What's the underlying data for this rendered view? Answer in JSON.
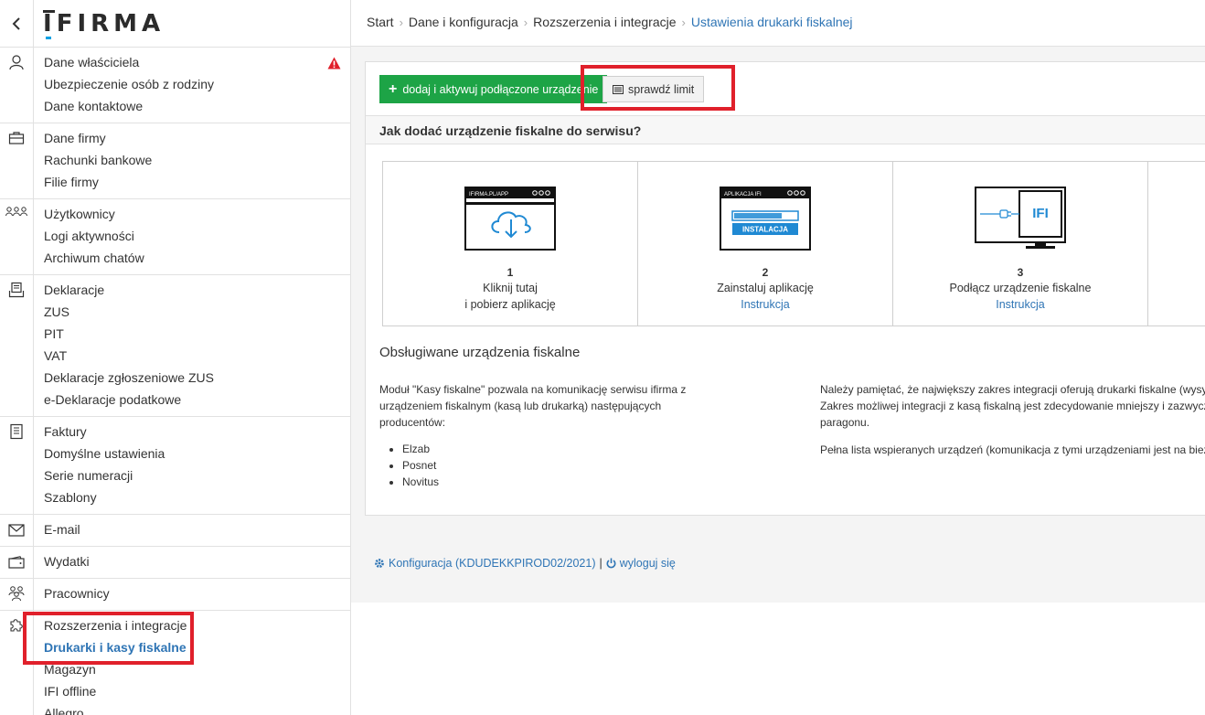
{
  "sidebar": {
    "logo_text": "IFIRMA",
    "back_label": "‹",
    "groups": [
      {
        "icon": "user-icon",
        "items": [
          "Dane właściciela",
          "Ubezpieczenie osób z rodziny",
          "Dane kontaktowe"
        ],
        "warning": true
      },
      {
        "icon": "briefcase-icon",
        "items": [
          "Dane firmy",
          "Rachunki bankowe",
          "Filie firmy"
        ]
      },
      {
        "icon": "users-icon",
        "items": [
          "Użytkownicy",
          "Logi aktywności",
          "Archiwum chatów"
        ]
      },
      {
        "icon": "declarations-icon",
        "items": [
          "Deklaracje",
          "ZUS",
          "PIT",
          "VAT",
          "Deklaracje zgłoszeniowe ZUS",
          "e-Deklaracje podatkowe"
        ]
      },
      {
        "icon": "invoice-icon",
        "items": [
          "Faktury",
          "Domyślne ustawienia",
          "Serie numeracji",
          "Szablony"
        ]
      },
      {
        "icon": "envelope-icon",
        "items": [
          "E-mail"
        ]
      },
      {
        "icon": "wallet-icon",
        "items": [
          "Wydatki"
        ]
      },
      {
        "icon": "employees-icon",
        "items": [
          "Pracownicy"
        ]
      },
      {
        "icon": "puzzle-icon",
        "items": [
          "Rozszerzenia i integracje",
          "Drukarki i kasy fiskalne",
          "Magazyn",
          "IFI offline",
          "Allegro"
        ],
        "active_index": 1
      }
    ]
  },
  "breadcrumb": [
    "Start",
    "Dane i konfiguracja",
    "Rozszerzenia i integracje",
    "Ustawienia drukarki fiskalnej"
  ],
  "toolbar": {
    "add_label": "dodaj i aktywuj podłączone urządzenie",
    "limit_label": "sprawdź limit"
  },
  "how_to": {
    "title": "Jak dodać urządzenie fiskalne do serwisu?",
    "steps": [
      {
        "number": "1",
        "line1": "Kliknij tutaj",
        "line2": "i pobierz aplikację",
        "window_label": "IFIRMA.PL/APP"
      },
      {
        "number": "2",
        "line1": "Zainstaluj aplikację",
        "line2": "Instrukcja",
        "window_label": "APLIKACJA IFI",
        "bar_label": "INSTALACJA"
      },
      {
        "number": "3",
        "line1": "Podłącz urządzenie fiskalne",
        "line2": "Instrukcja",
        "screen_label": "IFI"
      }
    ]
  },
  "devices": {
    "title": "Obsługiwane urządzenia fiskalne",
    "left_text": "Moduł \"Kasy fiskalne\" pozwala na komunikację serwisu ifirma z urządzeniem fiskalnym (kasą lub drukarką) następujących producentów:",
    "brands": [
      "Elzab",
      "Posnet",
      "Novitus"
    ],
    "right_p1_line1": "Należy pamiętać, że największy zakres integracji oferują drukarki fiskalne (wysy",
    "right_p1_line2": "Zakres możliwej integracji z kasą fiskalną jest zdecydowanie mniejszy i zazwycz",
    "right_p1_line3": "paragonu.",
    "right_p2": "Pełna lista wspieranych urządzeń (komunikacja z tymi urządzeniami jest na bież"
  },
  "footer": {
    "config_label": "Konfiguracja (KDUDEKKPIROD02/2021)",
    "separator": "|",
    "logout_label": "wyloguj się"
  },
  "colors": {
    "accent": "#2f75b5",
    "green": "#1da446",
    "highlight": "#e0202b"
  }
}
